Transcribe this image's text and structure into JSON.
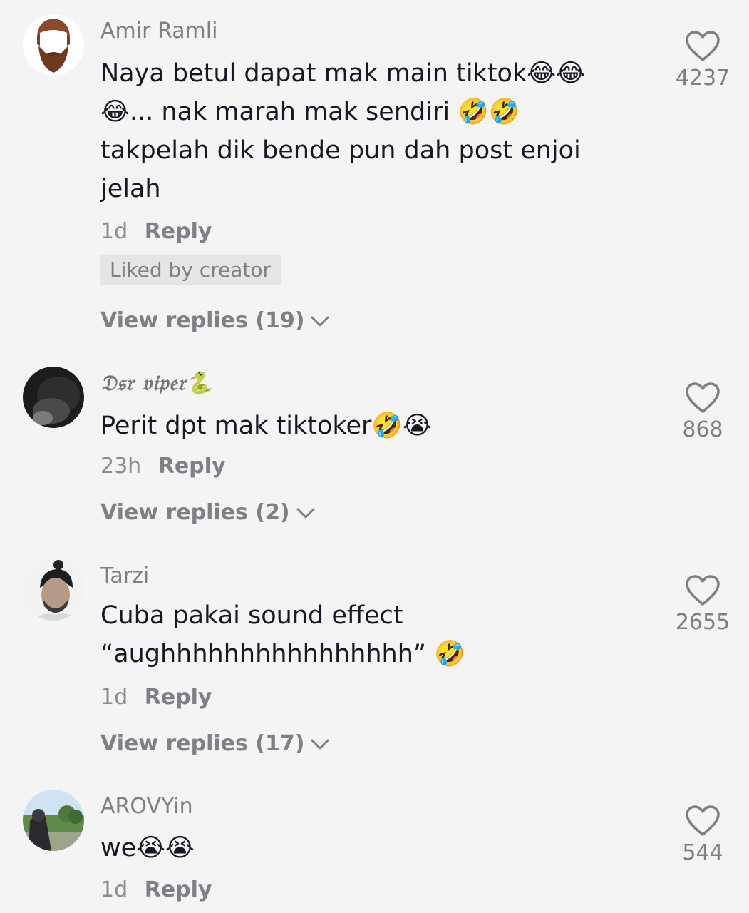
{
  "comments": [
    {
      "username": "Amir Ramli",
      "text": "Naya betul dapat mak main tiktok😂😂😂... nak marah mak sendiri 🤣🤣 takpelah dik bende pun dah post enjoi jelah",
      "time": "1d",
      "reply_label": "Reply",
      "badge": "Liked by creator",
      "view_replies": "View replies (19)",
      "likes": "4237",
      "avatar_icon": "bearded-man-avatar-icon"
    },
    {
      "username": "𝔇𝔰𝔯 𝔳𝔦𝔭𝔢𝔯🐍",
      "text": "Perit dpt mak tiktoker🤣😭",
      "time": "23h",
      "reply_label": "Reply",
      "view_replies": "View replies (2)",
      "likes": "868",
      "avatar_icon": "dark-photo-avatar-icon"
    },
    {
      "username": "Tarzi",
      "text": "Cuba pakai sound effect “aughhhhhhhhhhhhhhhh” 🤣",
      "time": "1d",
      "reply_label": "Reply",
      "view_replies": "View replies (17)",
      "likes": "2655",
      "avatar_icon": "man-bun-avatar-icon"
    },
    {
      "username": "AROVYin",
      "text": "we😭😭",
      "time": "1d",
      "reply_label": "Reply",
      "likes": "544",
      "avatar_icon": "landscape-photo-avatar-icon"
    }
  ],
  "icons": {
    "like": "heart-outline-icon",
    "expand": "chevron-down-icon"
  },
  "colors": {
    "background": "#f4f4f4",
    "text": "#161823",
    "secondary_text": "#7e7f85",
    "badge_background": "#e5e5e5"
  }
}
